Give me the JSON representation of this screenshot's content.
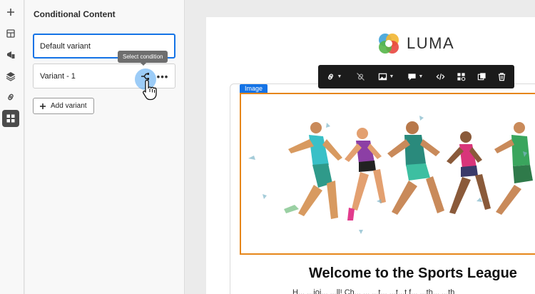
{
  "rail": {
    "items": [
      {
        "icon": "plus-icon",
        "active": false
      },
      {
        "icon": "fragment-icon",
        "active": false
      },
      {
        "icon": "assets-icon",
        "active": false
      },
      {
        "icon": "layers-icon",
        "active": false
      },
      {
        "icon": "link-icon",
        "active": false
      },
      {
        "icon": "conditional-content-icon",
        "active": true
      }
    ]
  },
  "panel": {
    "title": "Conditional Content",
    "variants": [
      {
        "label": "Default variant",
        "selected": true
      },
      {
        "label": "Variant - 1",
        "selected": false
      }
    ],
    "tooltip": "Select condition",
    "add_variant_label": "Add variant"
  },
  "email": {
    "brand": "LUMA",
    "image_label": "Image",
    "headline": "Welcome to the Sports League",
    "subline": "H... ...joi... ...ll! Ch... ... ...t... ...t...t f... ...th... ...th"
  },
  "toolbar": {
    "items": [
      "link-icon",
      "unlink-icon",
      "image-icon",
      "comment-icon",
      "code-icon",
      "conditional-icon",
      "duplicate-icon",
      "delete-icon"
    ]
  },
  "colors": {
    "accent": "#1473e6",
    "selection_orange": "#e68619",
    "toolbar_bg": "#1b1b1b",
    "cursor_highlight": "#4aa3f0"
  }
}
